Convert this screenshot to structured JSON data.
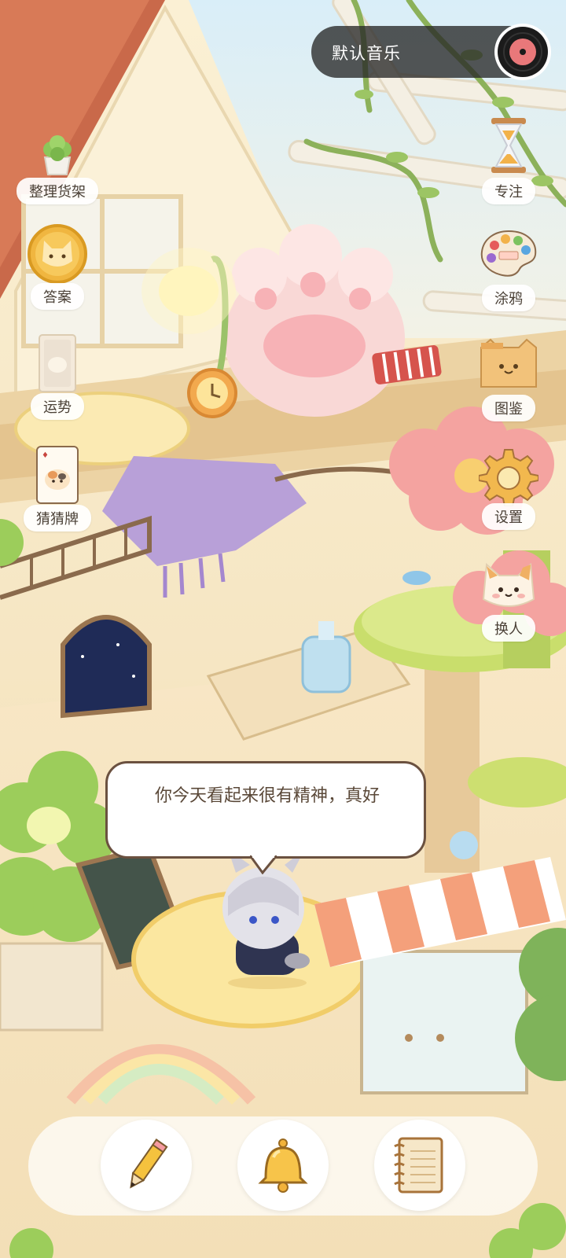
{
  "music": {
    "label": "默认音乐",
    "icon": "vinyl-record-icon"
  },
  "left_menu": [
    {
      "id": "organize-shelf",
      "label": "整理货架",
      "icon": "potted-plant-icon"
    },
    {
      "id": "answers",
      "label": "答案",
      "icon": "cat-coin-icon"
    },
    {
      "id": "fortune",
      "label": "运势",
      "icon": "fortune-card-icon"
    },
    {
      "id": "guess-cards",
      "label": "猜猜牌",
      "icon": "playing-card-icon"
    }
  ],
  "right_menu": [
    {
      "id": "focus",
      "label": "专注",
      "icon": "hourglass-icon"
    },
    {
      "id": "doodle",
      "label": "涂鸦",
      "icon": "paint-palette-icon"
    },
    {
      "id": "collection",
      "label": "图鉴",
      "icon": "cat-box-icon"
    },
    {
      "id": "settings",
      "label": "设置",
      "icon": "gear-icon"
    },
    {
      "id": "switch-character",
      "label": "换人",
      "icon": "cat-face-icon"
    }
  ],
  "speech": {
    "text": "你今天看起来很有精神，真好"
  },
  "bottom_bar": [
    {
      "id": "pencil",
      "icon": "pencil-icon"
    },
    {
      "id": "bell",
      "icon": "bell-icon"
    },
    {
      "id": "notebook",
      "icon": "notebook-icon"
    }
  ],
  "colors": {
    "wall": "#f6e3bf",
    "roof": "#c2623f",
    "sky": "#cfe6f2",
    "pill": "#2f2f2f",
    "label_text": "#4a4036",
    "bubble_border": "#6b5140"
  }
}
